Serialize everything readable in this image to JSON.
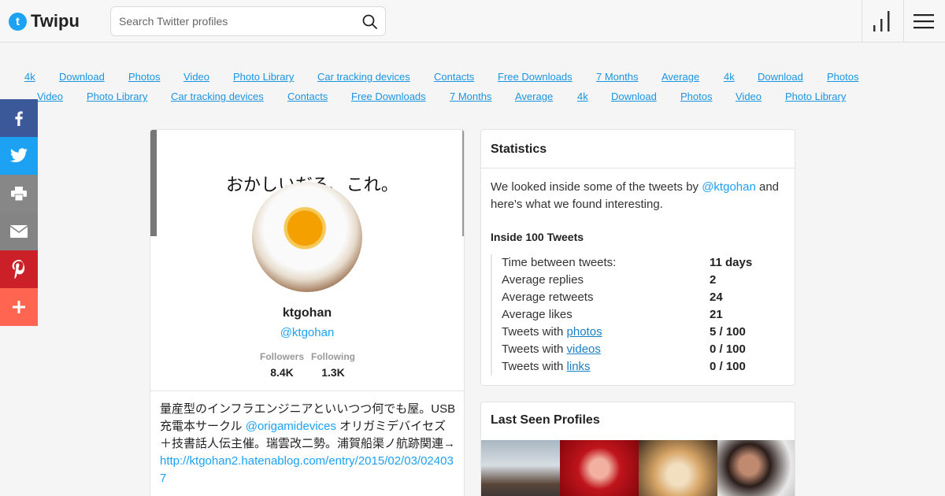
{
  "header": {
    "logo_letter": "t",
    "logo_text": "Twipu",
    "search_placeholder": "Search Twitter profiles"
  },
  "links_row1": [
    "4k",
    "Download",
    "Photos",
    "Video",
    "Photo Library",
    "Car tracking devices",
    "Contacts",
    "Free Downloads",
    "7 Months",
    "Average",
    "4k",
    "Download",
    "Photos"
  ],
  "links_row2": [
    "Video",
    "Photo Library",
    "Car tracking devices",
    "Contacts",
    "Free Downloads",
    "7 Months",
    "Average",
    "4k",
    "Download",
    "Photos",
    "Video",
    "Photo Library"
  ],
  "share_icons": [
    "facebook-icon",
    "twitter-icon",
    "print-icon",
    "email-icon",
    "pinterest-icon",
    "more-icon"
  ],
  "colors": {
    "accent": "#1da1f2",
    "facebook": "#3b5998",
    "pinterest": "#cb2027",
    "more": "#ff6550"
  },
  "profile": {
    "banner_text": "おかしいだろ、これ。",
    "name": "ktgohan",
    "handle": "@ktgohan",
    "followers_label": "Followers",
    "followers": "8.4K",
    "following_label": "Following",
    "following": "1.3K",
    "bio_1": "量産型のインフラエンジニアといいつつ何でも屋。USB充電本サークル ",
    "bio_mention": "@origamidevices",
    "bio_2": " オリガミデバイセズ＋技書話人伝主催。瑞雲改二勢。浦賀船渠ノ航跡関連→",
    "bio_link": "http://ktgohan2.hatenablog.com/entry/2015/02/03/024037"
  },
  "statistics": {
    "title": "Statistics",
    "intro_1": "We looked inside some of the tweets by ",
    "intro_handle": "@ktgohan",
    "intro_2": " and here's what we found interesting.",
    "subtitle": "Inside 100 Tweets",
    "rows": [
      {
        "label": "Time between tweets:",
        "value": "11 days"
      },
      {
        "label": "Average replies",
        "value": "2"
      },
      {
        "label": "Average retweets",
        "value": "24"
      },
      {
        "label": "Average likes",
        "value": "21"
      },
      {
        "label": "Tweets with ",
        "link": "photos",
        "value": "5 / 100"
      },
      {
        "label": "Tweets with ",
        "link": "videos",
        "value": "0 / 100"
      },
      {
        "label": "Tweets with ",
        "link": "links",
        "value": "0 / 100"
      }
    ]
  },
  "last_seen": {
    "title": "Last Seen Profiles"
  }
}
